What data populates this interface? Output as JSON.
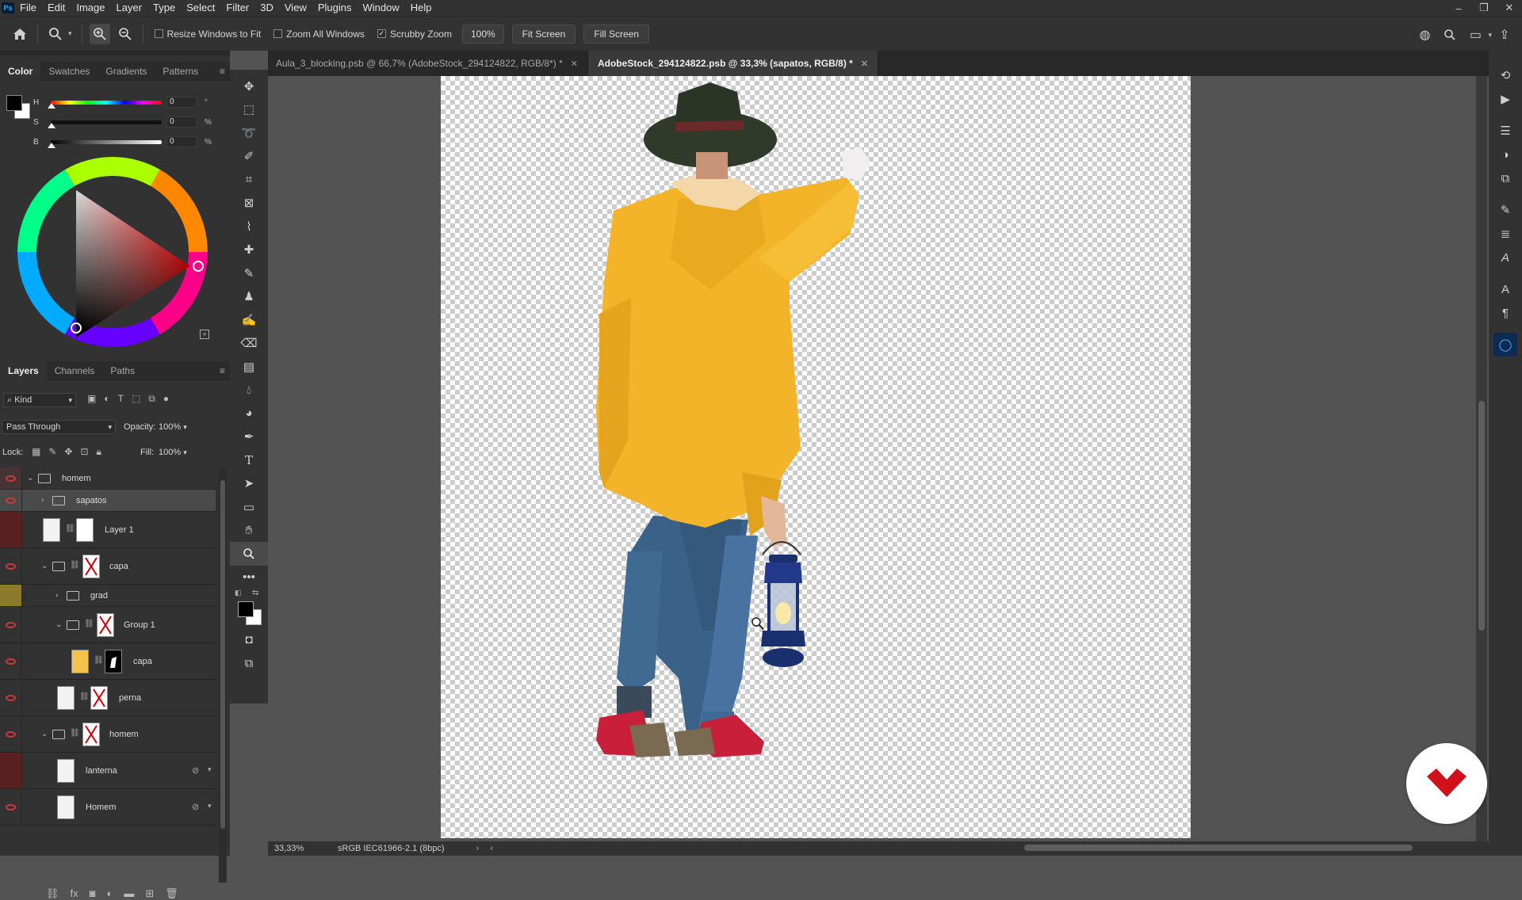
{
  "menubar": {
    "app_icon": "Ps",
    "items": [
      "File",
      "Edit",
      "Image",
      "Layer",
      "Type",
      "Select",
      "Filter",
      "3D",
      "View",
      "Plugins",
      "Window",
      "Help"
    ]
  },
  "options_bar": {
    "resize_windows": "Resize Windows to Fit",
    "zoom_all": "Zoom All Windows",
    "scrubby_zoom": "Scrubby Zoom",
    "zoom_value": "100%",
    "fit_screen": "Fit Screen",
    "fill_screen": "Fill Screen"
  },
  "color_panel": {
    "tabs": [
      "Color",
      "Swatches",
      "Gradients",
      "Patterns"
    ],
    "h_label": "H",
    "s_label": "S",
    "b_label": "B",
    "h_value": "0",
    "s_value": "0",
    "b_value": "0",
    "h_unit": "°",
    "s_unit": "%",
    "b_unit": "%"
  },
  "layers_panel": {
    "tabs": [
      "Layers",
      "Channels",
      "Paths"
    ],
    "kind_filter": "Kind",
    "blend_mode": "Pass Through",
    "opacity_label": "Opacity:",
    "opacity_value": "100%",
    "lock_label": "Lock:",
    "fill_label": "Fill:",
    "fill_value": "100%",
    "layers": [
      {
        "name": "homem"
      },
      {
        "name": "sapatos"
      },
      {
        "name": "Layer 1"
      },
      {
        "name": "capa"
      },
      {
        "name": "grad"
      },
      {
        "name": "Group 1"
      },
      {
        "name": "capa"
      },
      {
        "name": "perna"
      },
      {
        "name": "homem"
      },
      {
        "name": "lanterna"
      },
      {
        "name": "Homem"
      }
    ]
  },
  "documents": {
    "tabs": [
      {
        "title": "Aula_3_blocking.psb @ 66,7% (AdobeStock_294124822, RGB/8*) *"
      },
      {
        "title": "AdobeStock_294124822.psb @ 33,3% (sapatos, RGB/8) *"
      }
    ]
  },
  "status": {
    "zoom": "33,33%",
    "profile": "sRGB IEC61966-2.1 (8bpc)"
  },
  "colors": {
    "accent_red": "#c93a3a",
    "jacket": "#f3b42a",
    "hat": "#2f3a2a",
    "jeans": "#3a6288",
    "lantern": "#1a2f6e"
  }
}
